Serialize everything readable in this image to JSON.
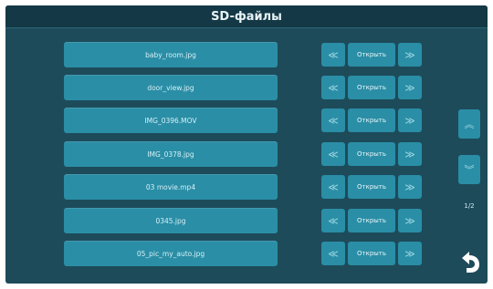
{
  "header": {
    "title": "SD-файлы"
  },
  "files": [
    {
      "name": "baby_room.jpg"
    },
    {
      "name": "door_view.jpg"
    },
    {
      "name": "IMG_0396.MOV"
    },
    {
      "name": "IMG_0378.jpg"
    },
    {
      "name": "03 movie.mp4"
    },
    {
      "name": "0345.jpg"
    },
    {
      "name": "05_pic_my_auto.jpg"
    }
  ],
  "actions": {
    "open_label": "Открыть",
    "prev_glyph": "≪",
    "next_glyph": "≫"
  },
  "pagination": {
    "page_up_glyph": "︽",
    "page_down_glyph": "︾",
    "indicator": "1/2"
  },
  "icons": {
    "back": "back-arrow-icon"
  },
  "colors": {
    "background": "#1d4b5a",
    "titlebar": "#143845",
    "button": "#2a8ea6",
    "text": "#e8f4f7"
  }
}
